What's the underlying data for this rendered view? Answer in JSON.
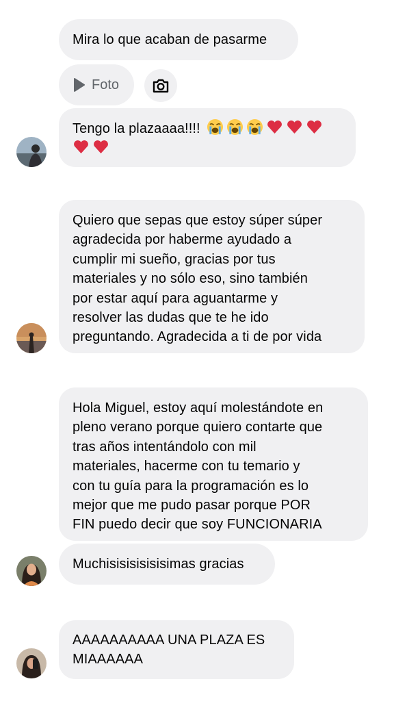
{
  "messages": {
    "m1": "Mira lo que acaban de pasarme",
    "foto_label": "Foto",
    "m2_text": "Tengo la plazaaaa!!!!",
    "m3": "Quiero que sepas que estoy súper súper\nagradecida por haberme ayudado a\ncumplir mi sueño, gracias por tus\nmateriales y no sólo eso, sino también\npor estar aquí para aguantarme y\nresolver las dudas que te he ido\npreguntando. Agradecida a ti de por vida",
    "m4": "Hola Miguel, estoy aquí molestándote en\npleno verano porque quiero contarte que\ntras años intentándolo con mil\nmateriales, hacerme con tu temario y\ncon tu guía para la programación es lo\nmejor que me pudo pasar porque POR\nFIN puedo decir que soy FUNCIONARIA",
    "m5": "Muchisisisisisisimas gracias",
    "m6": "AAAAAAAAAA UNA PLAZA ES\nMIAAAAAA"
  },
  "icons": [
    "play-icon",
    "camera-icon",
    "crying-emoji-icon",
    "red-heart-icon"
  ],
  "colors": {
    "bubble": "#f0f0f2",
    "text": "#050505",
    "icon_gray": "#62666b"
  }
}
